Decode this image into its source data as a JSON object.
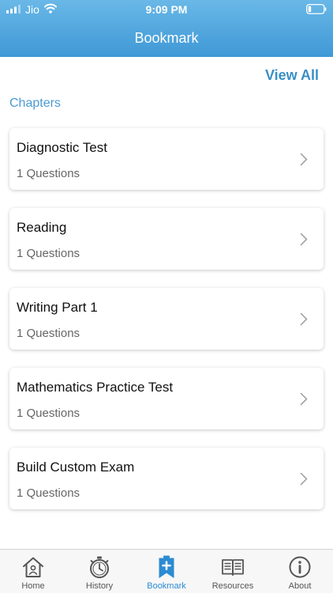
{
  "status_bar": {
    "carrier": "Jio",
    "time": "9:09 PM"
  },
  "header": {
    "title": "Bookmark"
  },
  "view_all_label": "View All",
  "section_title": "Chapters",
  "chapters": [
    {
      "title": "Diagnostic Test",
      "count": "1 Questions"
    },
    {
      "title": "Reading",
      "count": "1 Questions"
    },
    {
      "title": "Writing Part 1",
      "count": "1 Questions"
    },
    {
      "title": "Mathematics Practice Test",
      "count": "1 Questions"
    },
    {
      "title": "Build Custom Exam",
      "count": "1 Questions"
    }
  ],
  "tabbar": {
    "active": "Bookmark",
    "tabs": [
      {
        "label": "Home",
        "icon": "home-icon"
      },
      {
        "label": "History",
        "icon": "stopwatch-icon"
      },
      {
        "label": "Bookmark",
        "icon": "bookmark-icon"
      },
      {
        "label": "Resources",
        "icon": "book-icon"
      },
      {
        "label": "About",
        "icon": "info-icon"
      }
    ]
  },
  "colors": {
    "header_top": "#69b8e7",
    "header_bottom": "#3f98d6",
    "accent": "#3a8fc5",
    "active_tab": "#2c8bd2",
    "inactive_icon": "#555555"
  }
}
